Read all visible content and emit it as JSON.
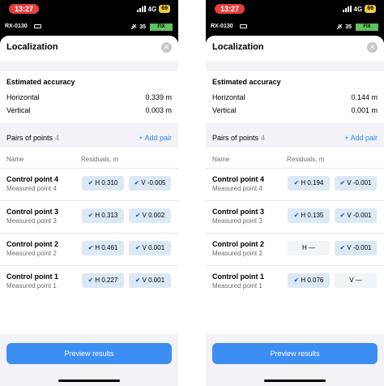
{
  "phones": [
    {
      "status": {
        "time": "13:27",
        "network": "4G",
        "battery": "69"
      },
      "device": {
        "name": "RX-0130",
        "satellites": "35",
        "fix": "FIX"
      },
      "title": "Localization",
      "accuracy": {
        "heading": "Estimated accuracy",
        "horizontal_label": "Horizontal",
        "horizontal_value": "0.339 m",
        "vertical_label": "Vertical",
        "vertical_value": "0.003 m"
      },
      "pairs": {
        "title": "Pairs of points",
        "count": "4",
        "add_label": "+ Add pair"
      },
      "columns": {
        "name": "Name",
        "residuals": "Residuals, m"
      },
      "rows": [
        {
          "name": "Control point 4",
          "measured": "Measured point 4",
          "h": "H 0.310",
          "v": "V -0.005",
          "h_on": true,
          "v_on": true
        },
        {
          "name": "Control point 3",
          "measured": "Measured point 3",
          "h": "H 0.313",
          "v": "V 0.002",
          "h_on": true,
          "v_on": true
        },
        {
          "name": "Control point 2",
          "measured": "Measured point 2",
          "h": "H 0.461",
          "v": "V 0.001",
          "h_on": true,
          "v_on": true
        },
        {
          "name": "Control point 1",
          "measured": "Measured point 1",
          "h": "H 0.227",
          "v": "V 0.001",
          "h_on": true,
          "v_on": true
        }
      ],
      "preview_label": "Preview results"
    },
    {
      "status": {
        "time": "13:27",
        "network": "4G",
        "battery": "69"
      },
      "device": {
        "name": "RX-0130",
        "satellites": "35",
        "fix": "FIX"
      },
      "title": "Localization",
      "accuracy": {
        "heading": "Estimated accuracy",
        "horizontal_label": "Horizontal",
        "horizontal_value": "0.144 m",
        "vertical_label": "Vertical",
        "vertical_value": "0.001 m"
      },
      "pairs": {
        "title": "Pairs of points",
        "count": "4",
        "add_label": "+ Add pair"
      },
      "columns": {
        "name": "Name",
        "residuals": "Residuals, m"
      },
      "rows": [
        {
          "name": "Control point 4",
          "measured": "Measured point 4",
          "h": "H 0.194",
          "v": "V -0.001",
          "h_on": true,
          "v_on": true
        },
        {
          "name": "Control point 3",
          "measured": "Measured point 3",
          "h": "H 0.135",
          "v": "V -0.001",
          "h_on": true,
          "v_on": true
        },
        {
          "name": "Control point 2",
          "measured": "Measured point 2",
          "h": "H —",
          "v": "V -0.001",
          "h_on": false,
          "v_on": true
        },
        {
          "name": "Control point 1",
          "measured": "Measured point 1",
          "h": "H 0.076",
          "v": "V —",
          "h_on": true,
          "v_on": false
        }
      ],
      "preview_label": "Preview results"
    }
  ],
  "icons": {
    "checkmark": "checkmark-icon",
    "close": "close-icon",
    "signal": "signal-bars-icon",
    "satellite": "satellite-icon",
    "device_battery": "battery-icon"
  },
  "colors": {
    "accent": "#2e86e8",
    "button": "#3d8ef2",
    "chip_active": "#dde8f5",
    "chip_inactive": "#f0f3f7",
    "time_pill": "#e5403d",
    "fix_badge": "#5ec25e",
    "phone_battery": "#f0c93c"
  }
}
